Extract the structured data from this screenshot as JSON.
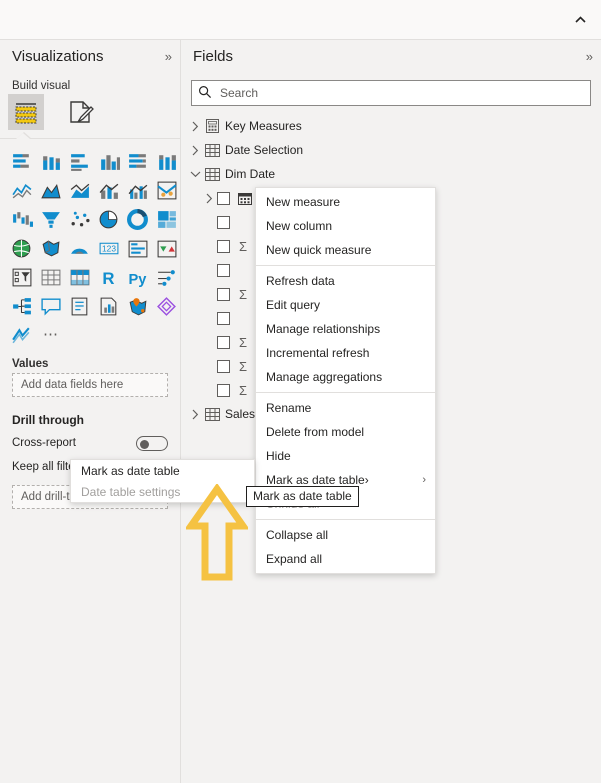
{
  "app": {
    "accent_yellow": "#F5C242",
    "pane_bg": "#f3f2f1",
    "topbar_collapse_icon": "chevron-up-icon"
  },
  "visualizations": {
    "title": "Visualizations",
    "collapse_label": "»",
    "build_visual_label": "Build visual",
    "tabs": [
      {
        "name": "build-visual-tab",
        "icon": "table-visual-icon",
        "selected": true
      },
      {
        "name": "format-visual-tab",
        "icon": "paintbrush-page-icon",
        "selected": false
      }
    ],
    "gallery": [
      "stacked-bar-chart-icon",
      "stacked-column-chart-icon",
      "clustered-bar-chart-icon",
      "clustered-column-chart-icon",
      "hundred-percent-stacked-bar-chart-icon",
      "hundred-percent-stacked-column-chart-icon",
      "line-chart-icon",
      "area-chart-icon",
      "stacked-area-chart-icon",
      "line-and-stacked-column-chart-icon",
      "line-and-clustered-column-chart-icon",
      "ribbon-chart-icon",
      "waterfall-chart-icon",
      "funnel-chart-icon",
      "scatter-chart-icon",
      "pie-chart-icon",
      "donut-chart-icon",
      "treemap-icon",
      "map-icon",
      "filled-map-icon",
      "arcgis-map-icon",
      "card-icon",
      "multi-row-card-icon",
      "kpi-icon",
      "slicer-icon",
      "table-icon",
      "matrix-icon",
      "r-script-visual-icon",
      "python-visual-icon",
      "key-influencers-icon",
      "decomposition-tree-icon",
      "qna-icon",
      "smart-narrative-icon",
      "paginated-report-icon",
      "azure-map-icon",
      "power-apps-icon",
      "power-automate-icon",
      "more-options-icon"
    ],
    "wells": {
      "values_label": "Values",
      "values_placeholder": "Add data fields here",
      "drill_through_label": "Drill through",
      "cross_report_label": "Cross-report",
      "keep_all_filters_label": "Keep all filters",
      "drill_placeholder": "Add drill-through fields here"
    }
  },
  "fields": {
    "title": "Fields",
    "collapse_label": "»",
    "search": {
      "value": "",
      "placeholder": "Search",
      "icon": "search-icon"
    },
    "tree": [
      {
        "label": "Key Measures",
        "icon": "measure-table-icon",
        "twist": "collapsed",
        "level": 0,
        "type": "table"
      },
      {
        "label": "Date Selection",
        "icon": "table-icon",
        "twist": "collapsed",
        "level": 0,
        "type": "table"
      },
      {
        "label": "Dim Date",
        "icon": "table-icon",
        "twist": "expanded",
        "level": 0,
        "type": "table"
      },
      {
        "label": "",
        "icon": "date-hierarchy-icon",
        "twist": "collapsed",
        "level": 1,
        "type": "hierarchy",
        "checkbox": true
      },
      {
        "label": "",
        "icon": "",
        "twist": "",
        "level": 1,
        "type": "column",
        "checkbox": true
      },
      {
        "label": "",
        "icon": "",
        "twist": "",
        "level": 1,
        "type": "measure",
        "checkbox": true,
        "sigma": true
      },
      {
        "label": "",
        "icon": "",
        "twist": "",
        "level": 1,
        "type": "column",
        "checkbox": true
      },
      {
        "label": "",
        "icon": "",
        "twist": "",
        "level": 1,
        "type": "measure",
        "checkbox": true,
        "sigma": true
      },
      {
        "label": "",
        "icon": "",
        "twist": "",
        "level": 1,
        "type": "column",
        "checkbox": true
      },
      {
        "label": "",
        "icon": "",
        "twist": "",
        "level": 1,
        "type": "measure",
        "checkbox": true,
        "sigma": true
      },
      {
        "label": "",
        "icon": "",
        "twist": "",
        "level": 1,
        "type": "measure",
        "checkbox": true,
        "sigma": true
      },
      {
        "label": "",
        "icon": "",
        "twist": "",
        "level": 1,
        "type": "measure",
        "checkbox": true,
        "sigma": true
      },
      {
        "label": "Sales",
        "icon": "table-icon",
        "twist": "collapsed",
        "level": 0,
        "type": "table"
      }
    ]
  },
  "context_menu": {
    "groups": [
      {
        "items": [
          {
            "label": "New measure",
            "disabled": false,
            "submenu": false
          },
          {
            "label": "New column",
            "disabled": false,
            "submenu": false
          },
          {
            "label": "New quick measure",
            "disabled": false,
            "submenu": false
          }
        ]
      },
      {
        "items": [
          {
            "label": "Refresh data",
            "disabled": false,
            "submenu": false
          },
          {
            "label": "Edit query",
            "disabled": false,
            "submenu": false
          },
          {
            "label": "Manage relationships",
            "disabled": false,
            "submenu": false
          },
          {
            "label": "Incremental refresh",
            "disabled": false,
            "submenu": false
          },
          {
            "label": "Manage aggregations",
            "disabled": false,
            "submenu": false
          }
        ]
      },
      {
        "items": [
          {
            "label": "Rename",
            "disabled": false,
            "submenu": false
          },
          {
            "label": "Delete from model",
            "disabled": false,
            "submenu": false
          },
          {
            "label": "Hide",
            "disabled": false,
            "submenu": false
          },
          {
            "label": "Mark as date table",
            "disabled": false,
            "submenu": true,
            "submenu_glyph": "›"
          },
          {
            "label": "Unhide all",
            "disabled": true,
            "submenu": false
          }
        ]
      },
      {
        "items": [
          {
            "label": "Collapse all",
            "disabled": false,
            "submenu": false
          },
          {
            "label": "Expand all",
            "disabled": false,
            "submenu": false
          }
        ]
      }
    ]
  },
  "flyout_menu": {
    "items": [
      {
        "label": "Mark as date table",
        "disabled": false
      },
      {
        "label": "Date table settings",
        "disabled": true
      }
    ]
  },
  "tooltip": {
    "text": "Mark as date table"
  },
  "annotation": {
    "type": "up-arrow",
    "color": "#F5C242"
  }
}
